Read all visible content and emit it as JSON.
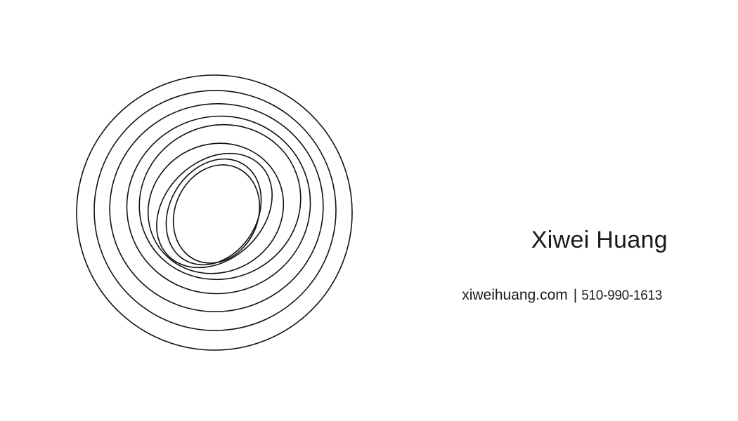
{
  "card": {
    "name": "Xiwei Huang",
    "website": "xiweihuang.com",
    "separator": "|",
    "phone": "510-990-1613"
  },
  "logo": {
    "icon": "concentric-rings-icon",
    "stroke_color": "#111111",
    "background_color": "#ffffff"
  }
}
